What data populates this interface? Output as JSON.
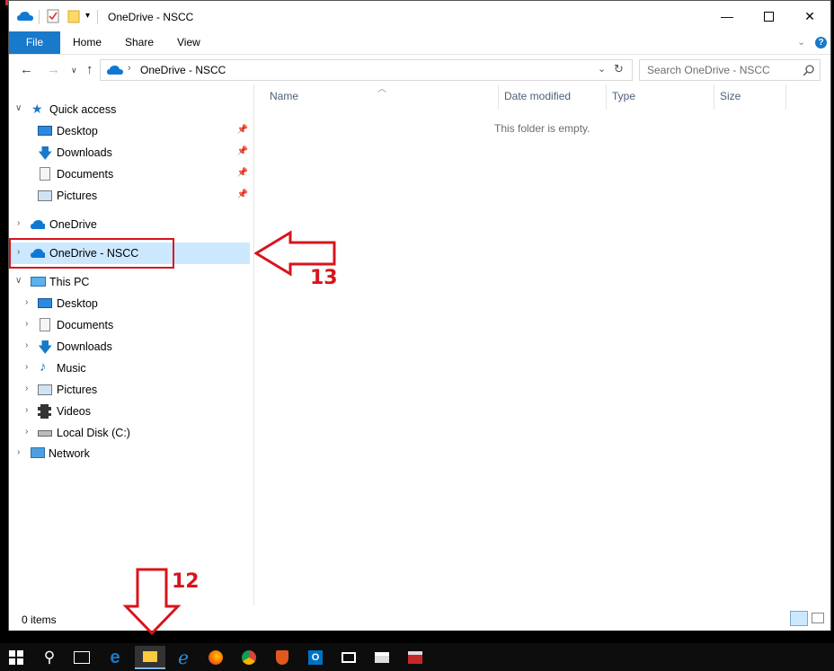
{
  "window": {
    "title": "OneDrive - NSCC"
  },
  "ribbon": {
    "tabs": [
      "File",
      "Home",
      "Share",
      "View"
    ]
  },
  "address": {
    "path": "OneDrive - NSCC",
    "search_placeholder": "Search OneDrive - NSCC"
  },
  "nav": {
    "quick_access": "Quick access",
    "qa_items": [
      "Desktop",
      "Downloads",
      "Documents",
      "Pictures"
    ],
    "onedrive": "OneDrive",
    "onedrive_nscc": "OneDrive - NSCC",
    "this_pc": "This PC",
    "pc_items": [
      "Desktop",
      "Documents",
      "Downloads",
      "Music",
      "Pictures",
      "Videos",
      "Local Disk (C:)"
    ],
    "network": "Network"
  },
  "columns": [
    "Name",
    "Date modified",
    "Type",
    "Size"
  ],
  "empty_message": "This folder is empty.",
  "status": {
    "items": "0 items"
  },
  "annotations": {
    "step_13": "13",
    "step_12": "12"
  },
  "colors": {
    "accent": "#1979ca",
    "selection": "#cce8ff",
    "annotation": "#d7141c"
  }
}
